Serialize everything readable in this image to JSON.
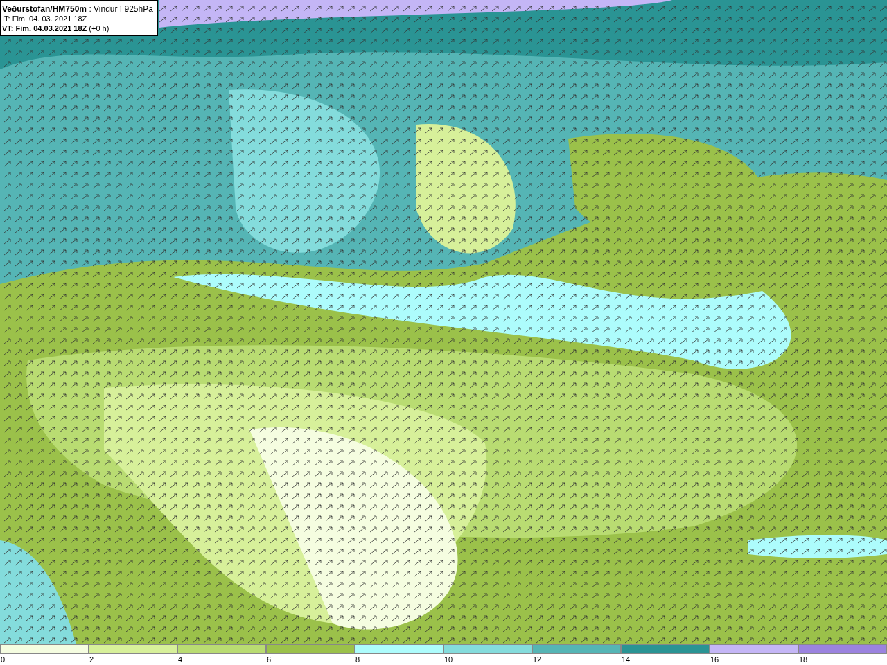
{
  "title_box": {
    "lines": [
      "**Veðurstofan/HM750m** : Vindur í 925hPa",
      "IT: Fim. 04. 03. 2021 18Z",
      "**VT: Fim. 04.03.2021 18Z** (+0 h)"
    ]
  },
  "legend": [
    {
      "label": "0",
      "color": "#f5fde0"
    },
    {
      "label": "2",
      "color": "#d7f09a"
    },
    {
      "label": "4",
      "color": "#b9dc72"
    },
    {
      "label": "6",
      "color": "#9bc14a"
    },
    {
      "label": "8",
      "color": "#adfcfc"
    },
    {
      "label": "10",
      "color": "#84dcdc"
    },
    {
      "label": "12",
      "color": "#55b5b5"
    },
    {
      "label": "14",
      "color": "#2a9494"
    },
    {
      "label": "16",
      "color": "#c4b6f6"
    },
    {
      "label": "18",
      "color": "#9b83df"
    }
  ]
}
